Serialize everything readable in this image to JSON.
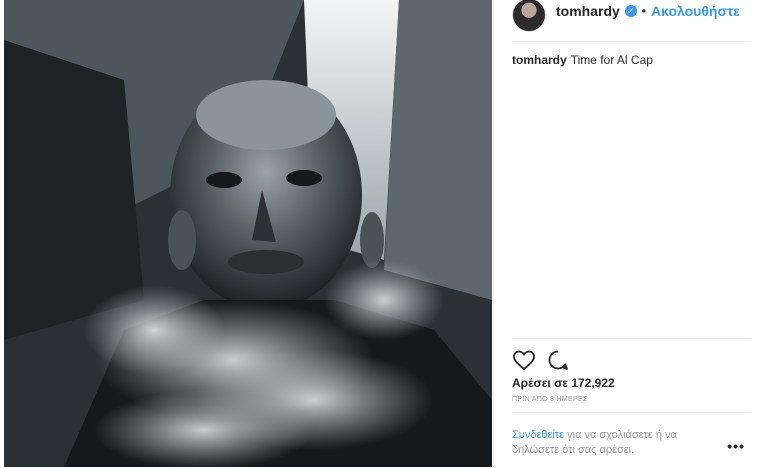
{
  "header": {
    "username": "tomhardy",
    "verified_badge": "✓",
    "separator": "•",
    "follow_label": "Ακολουθήστε"
  },
  "caption": {
    "username": "tomhardy",
    "text": "Time for Al Cap"
  },
  "actions": {
    "like_icon": "heart-icon",
    "comment_icon": "comment-icon",
    "more_icon": "more-options-icon"
  },
  "likes": "Αρέσει σε 172,922",
  "time_ago": "ΠΡΙΝ ΑΠΟ 3 ΗΜΕΡΕΣ",
  "login_prompt": {
    "link": "Συνδεθείτε",
    "text": " για να σχολιάσετε ή να δηλώσετε ότι σας αρέσει."
  },
  "more_label": "•••",
  "colors": {
    "accent": "#3897f0",
    "text": "#262626",
    "muted": "#999999"
  }
}
